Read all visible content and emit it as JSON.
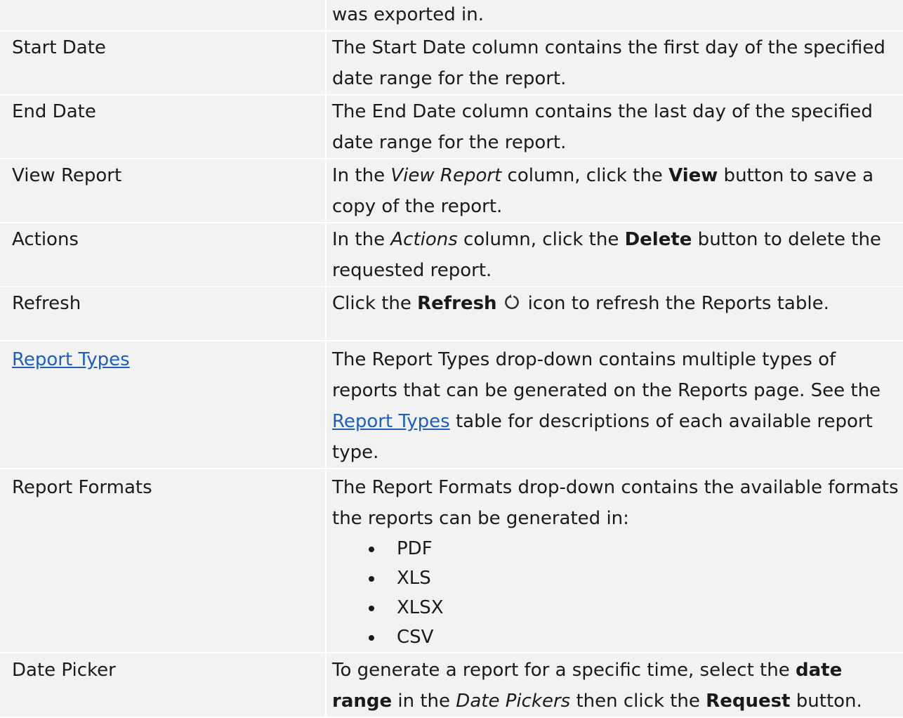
{
  "rows": [
    {
      "term": "",
      "desc": "was exported in."
    },
    {
      "term": "Start Date",
      "desc": "The Start Date column contains the first day of the specified date range for the report."
    },
    {
      "term": "End Date",
      "desc": "The End Date column contains the last day of the specified date range for the report."
    },
    {
      "term": "View Report",
      "desc_parts": [
        "In the ",
        "View Report",
        " column, click the ",
        "View",
        " button to save a copy of the report."
      ]
    },
    {
      "term": "Actions",
      "desc_parts": [
        "In the ",
        "Actions",
        " column, click the ",
        "Delete",
        " button to delete the requested report."
      ]
    },
    {
      "term": "Refresh",
      "desc_parts": [
        "Click the ",
        "Refresh",
        "icon to refresh the Reports table."
      ],
      "icon": "refresh-icon"
    },
    {
      "term": "Report Types",
      "desc_parts": [
        "The Report Types drop-down contains multiple types of reports that can be generated on the Reports page. See the ",
        "Report Types",
        " table for descriptions of each available report type."
      ]
    },
    {
      "term": "Report Formats",
      "desc": "The Report Formats drop-down contains the available formats the reports can be generated in:",
      "formats": [
        "PDF",
        "XLS",
        "XLSX",
        "CSV"
      ]
    },
    {
      "term": "Date Picker",
      "desc_parts": [
        "To generate a report for a specific time, select the ",
        "date range",
        " in the ",
        "Date Pickers",
        " then click the ",
        "Request",
        " button."
      ]
    }
  ],
  "colors": {
    "row_background": "#f2f2f2",
    "link": "#1f5fb8",
    "text": "#1a1a1a"
  }
}
